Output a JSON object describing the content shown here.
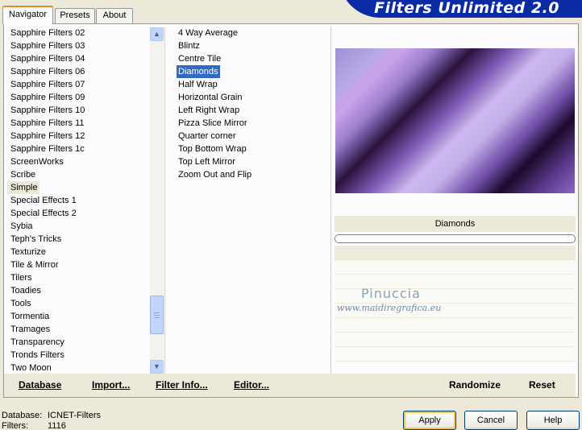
{
  "app_title": "Filters Unlimited 2.0",
  "tabs": [
    {
      "label": "Navigator",
      "active": true
    },
    {
      "label": "Presets",
      "active": false
    },
    {
      "label": "About",
      "active": false
    }
  ],
  "categories": {
    "items": [
      "Sapphire Filters 02",
      "Sapphire Filters 03",
      "Sapphire Filters 04",
      "Sapphire Filters 06",
      "Sapphire Filters 07",
      "Sapphire Filters 09",
      "Sapphire Filters 10",
      "Sapphire Filters 11",
      "Sapphire Filters 12",
      "Sapphire Filters 1c",
      "ScreenWorks",
      "Scribe",
      "Simple",
      "Special Effects 1",
      "Special Effects 2",
      "Sybia",
      "Teph's Tricks",
      "Texturize",
      "Tile & Mirror",
      "Tilers",
      "Toadies",
      "Tools",
      "Tormentia",
      "Tramages",
      "Transparency",
      "Tronds Filters",
      "Two Moon"
    ],
    "selected": "Simple"
  },
  "filters": {
    "items": [
      "4 Way Average",
      "Blintz",
      "Centre Tile",
      "Diamonds",
      "Half Wrap",
      "Horizontal Grain",
      "Left Right Wrap",
      "Pizza Slice Mirror",
      "Quarter corner",
      "Top Bottom Wrap",
      "Top Left Mirror",
      "Zoom Out and Flip"
    ],
    "selected": "Diamonds"
  },
  "preview": {
    "filter_name": "Diamonds",
    "colors": [
      "#b8a9e5",
      "#2a1240",
      "#cdb8ee",
      "#1c0a2c"
    ]
  },
  "watermark": {
    "name": "Pinuccia",
    "url": "www.maidiregrafica.eu"
  },
  "bottom_buttons": {
    "database": "Database",
    "import": "Import...",
    "filter_info": "Filter Info...",
    "editor": "Editor...",
    "randomize": "Randomize",
    "reset": "Reset"
  },
  "status": {
    "database_label": "Database:",
    "database_value": "ICNET-Filters",
    "filters_label": "Filters:",
    "filters_value": "1116"
  },
  "dialog_buttons": {
    "apply": "Apply",
    "cancel": "Cancel",
    "help": "Help"
  },
  "icons": {
    "scroll_up": "chevron-up-icon",
    "scroll_down": "chevron-down-icon"
  },
  "colors": {
    "selection": "#316ac5",
    "banner": "#0a2aa6",
    "tab_accent": "#e68b2c"
  }
}
